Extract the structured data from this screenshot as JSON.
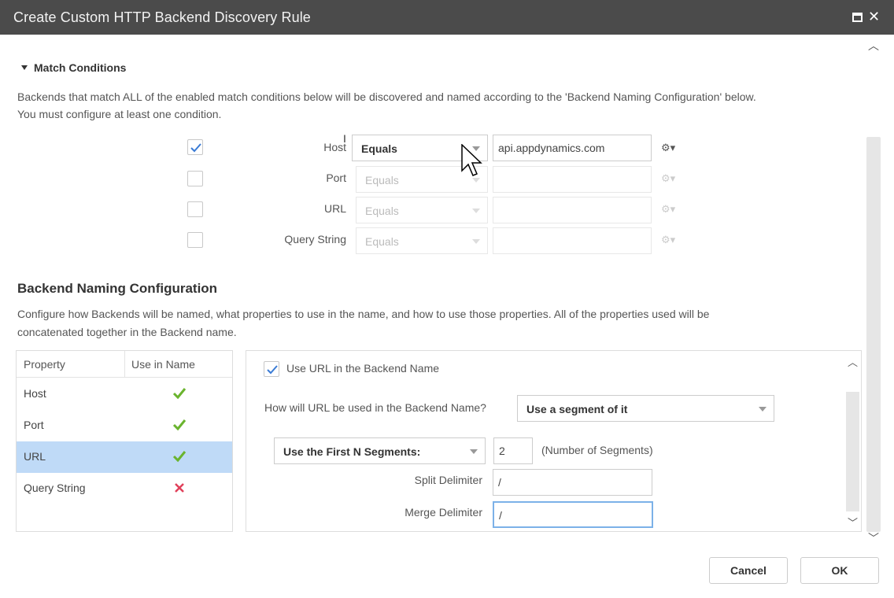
{
  "window": {
    "title": "Create Custom HTTP Backend Discovery Rule",
    "maximize_icon": "maximize-icon",
    "close_glyph": "✕"
  },
  "match": {
    "header": "Match Conditions",
    "description_line1": "Backends that match ALL of the enabled match conditions below will be discovered and named according to the 'Backend Naming Configuration' below.",
    "description_line2": "You must configure at least one condition.",
    "conditions": [
      {
        "label": "Host",
        "checked": true,
        "operator": "Equals",
        "value": "api.appdynamics.com"
      },
      {
        "label": "Port",
        "checked": false,
        "operator": "Equals",
        "value": ""
      },
      {
        "label": "URL",
        "checked": false,
        "operator": "Equals",
        "value": ""
      },
      {
        "label": "Query String",
        "checked": false,
        "operator": "Equals",
        "value": ""
      }
    ]
  },
  "naming": {
    "header": "Backend Naming Configuration",
    "description_line1": "Configure how Backends will be named, what properties to use in the name, and how to use those properties.  All of the properties used will be",
    "description_line2": "concatenated together in the Backend name.",
    "table": {
      "col_property": "Property",
      "col_use": "Use in Name",
      "rows": [
        {
          "name": "Host",
          "use": "check",
          "selected": false
        },
        {
          "name": "Port",
          "use": "check",
          "selected": false
        },
        {
          "name": "URL",
          "use": "check",
          "selected": true
        },
        {
          "name": "Query String",
          "use": "cross",
          "selected": false
        }
      ]
    },
    "config": {
      "use_checkbox_label": "Use URL in the Backend Name",
      "use_checked": true,
      "how_label": "How will URL be used in the Backend Name?",
      "how_value": "Use a segment of it",
      "segment_select": "Use the First N Segments:",
      "segment_count": "2",
      "segment_hint": "(Number of Segments)",
      "split_label": "Split Delimiter",
      "split_value": "/",
      "merge_label": "Merge Delimiter",
      "merge_value": "/"
    }
  },
  "footer": {
    "cancel": "Cancel",
    "ok": "OK"
  },
  "colors": {
    "titlebar": "#4b4b4b",
    "selected_row": "#bfdaf7",
    "check_green": "#6ab42e",
    "cross_red": "#e0405a",
    "checkbox_blue": "#3a7bd5"
  }
}
